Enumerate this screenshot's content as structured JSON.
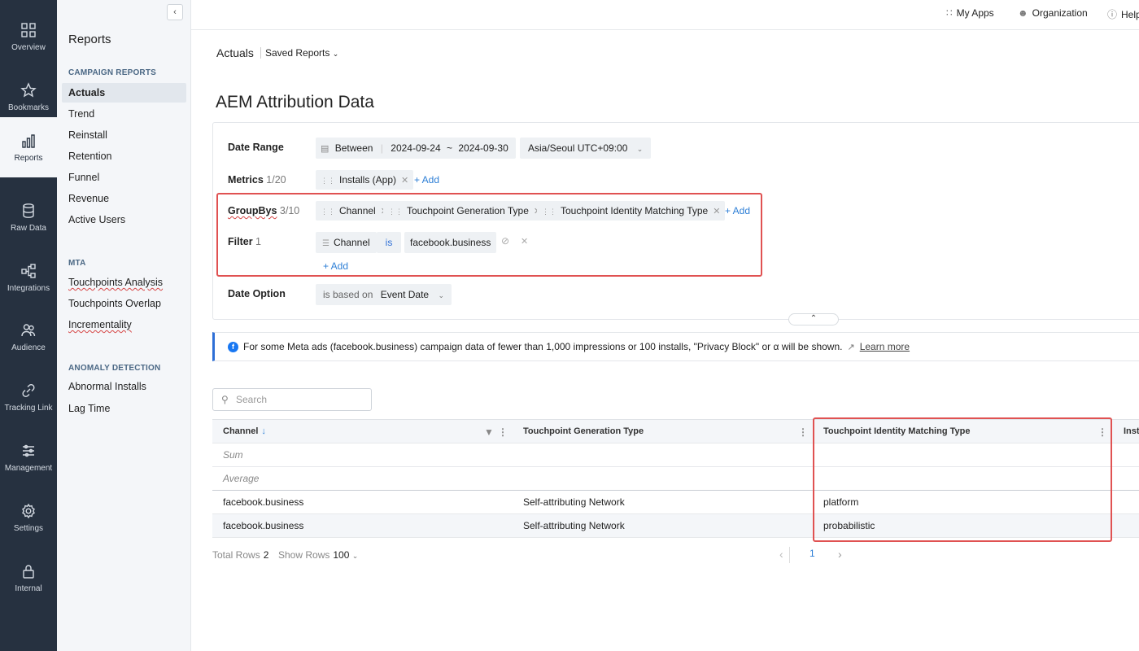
{
  "rail": [
    {
      "label": "Overview",
      "icon": "grid-icon"
    },
    {
      "label": "Bookmarks",
      "icon": "star-icon"
    },
    {
      "label": "Reports",
      "icon": "bar-chart-icon"
    },
    {
      "label": "Raw Data",
      "icon": "database-icon"
    },
    {
      "label": "Integrations",
      "icon": "flow-icon"
    },
    {
      "label": "Audience",
      "icon": "people-icon"
    },
    {
      "label": "Tracking Link",
      "icon": "link-icon"
    },
    {
      "label": "Management",
      "icon": "sliders-icon"
    },
    {
      "label": "Settings",
      "icon": "gear-icon"
    },
    {
      "label": "Internal",
      "icon": "lock-icon"
    }
  ],
  "submenu": {
    "title": "Reports",
    "sections": [
      {
        "heading": "CAMPAIGN REPORTS",
        "items": [
          "Actuals",
          "Trend",
          "Reinstall",
          "Retention",
          "Funnel",
          "Revenue",
          "Active Users"
        ]
      },
      {
        "heading": "MTA",
        "items": [
          "Touchpoints Analysis",
          "Touchpoints Overlap",
          "Incrementality"
        ]
      },
      {
        "heading": "ANOMALY DETECTION",
        "items": [
          "Abnormal Installs",
          "Lag Time"
        ]
      }
    ]
  },
  "topbar": {
    "my_apps": "My Apps",
    "organization": "Organization",
    "help": "Help"
  },
  "header": {
    "crumb": "Actuals",
    "saved_reports": "Saved Reports",
    "title": "AEM Attribution Data"
  },
  "filters": {
    "date_range": {
      "label": "Date Range",
      "mode": "Between",
      "from": "2024-09-24",
      "sep": "~",
      "to": "2024-09-30",
      "timezone": "Asia/Seoul UTC+09:00"
    },
    "metrics": {
      "label": "Metrics",
      "count": "1/20",
      "chips": [
        "Installs (App)"
      ],
      "add": "+ Add"
    },
    "groupbys": {
      "label": "GroupBys",
      "count": "3/10",
      "chips": [
        "Channel",
        "Touchpoint Generation Type",
        "Touchpoint Identity Matching Type"
      ],
      "add": "+ Add"
    },
    "filter": {
      "label": "Filter",
      "count": "1",
      "field": "Channel",
      "op": "is",
      "value": "facebook.business",
      "add": "+ Add"
    },
    "date_option": {
      "label": "Date Option",
      "prefix": "is based on",
      "value": "Event Date"
    }
  },
  "notice": {
    "text": "For some Meta ads (facebook.business) campaign data of fewer than 1,000 impressions or 100 installs, \"Privacy Block\" or α will be shown.",
    "link": "Learn more"
  },
  "search": {
    "placeholder": "Search"
  },
  "table": {
    "columns": [
      "Channel",
      "Touchpoint Generation Type",
      "Touchpoint Identity Matching Type",
      "Insta"
    ],
    "summary": [
      "Sum",
      "Average"
    ],
    "rows": [
      [
        "facebook.business",
        "Self-attributing Network",
        "platform"
      ],
      [
        "facebook.business",
        "Self-attributing Network",
        "probabilistic"
      ]
    ]
  },
  "footer": {
    "total_rows_label": "Total Rows",
    "total_rows": "2",
    "show_rows_label": "Show Rows",
    "show_rows": "100",
    "page": "1"
  },
  "colors": {
    "rail_bg": "#263140",
    "accent_blue": "#2e7fd6",
    "highlight_red": "#e05252"
  }
}
